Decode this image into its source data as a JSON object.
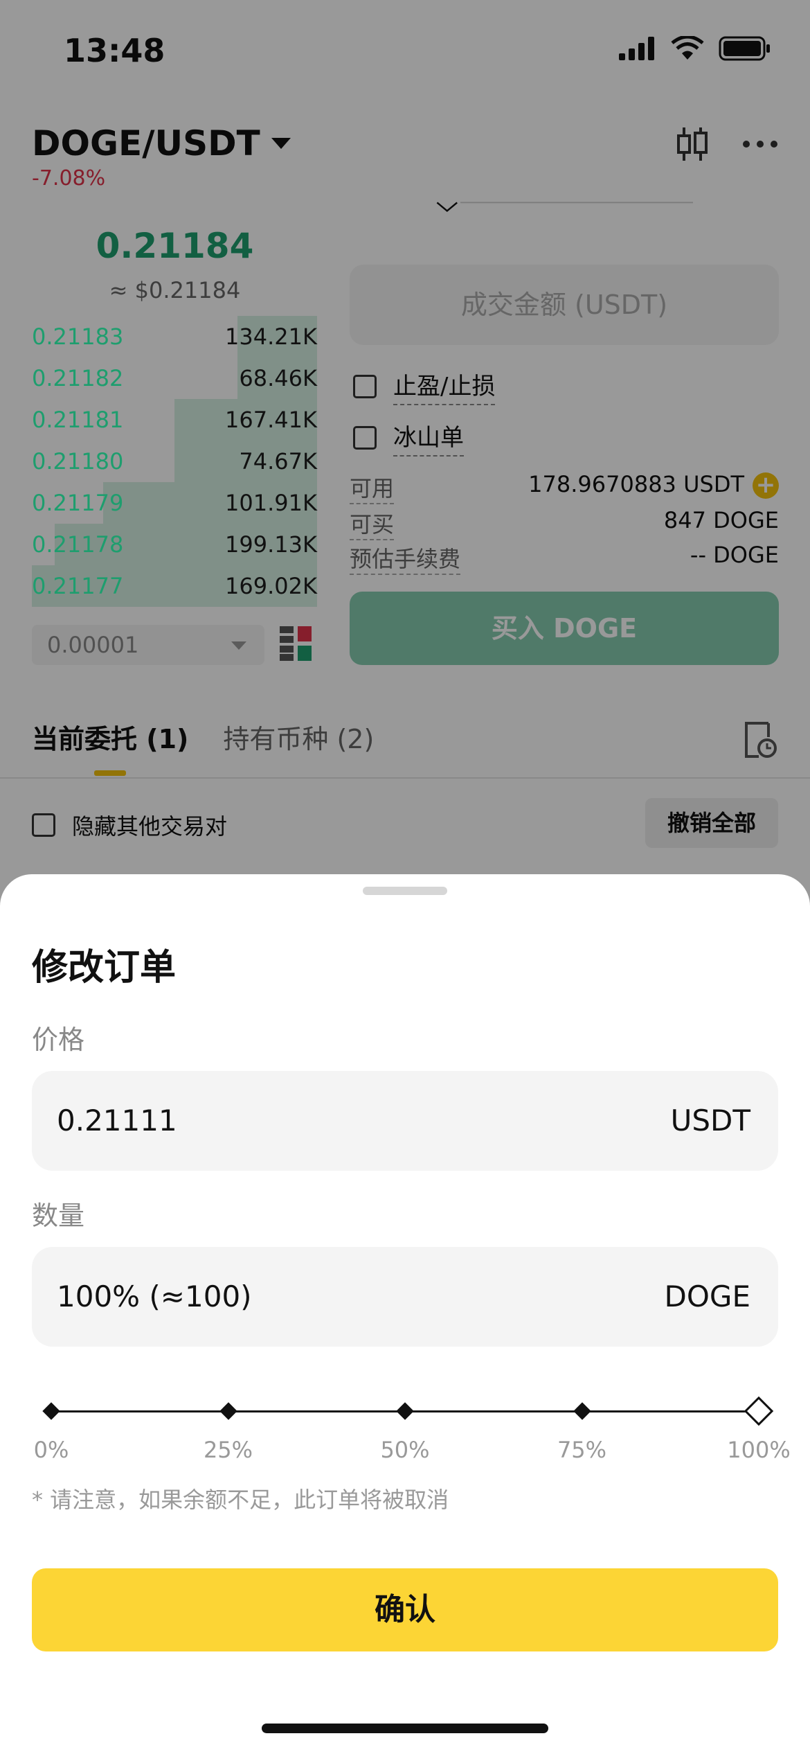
{
  "status_bar": {
    "time": "13:48"
  },
  "header": {
    "pair": "DOGE/USDT",
    "change": "-7.08%"
  },
  "ticker": {
    "last_price": "0.21184",
    "last_price_usd": "≈ $0.21184"
  },
  "order_book": {
    "rows": [
      {
        "price": "0.21183",
        "qty": "134.21K",
        "depth": 0.28
      },
      {
        "price": "0.21182",
        "qty": "68.46K",
        "depth": 0.28
      },
      {
        "price": "0.21181",
        "qty": "167.41K",
        "depth": 0.5
      },
      {
        "price": "0.21180",
        "qty": "74.67K",
        "depth": 0.5
      },
      {
        "price": "0.21179",
        "qty": "101.91K",
        "depth": 0.75
      },
      {
        "price": "0.21178",
        "qty": "199.13K",
        "depth": 0.92
      },
      {
        "price": "0.21177",
        "qty": "169.02K",
        "depth": 1.0
      }
    ],
    "precision": "0.00001"
  },
  "order_form": {
    "amount_placeholder": "成交金额 (USDT)",
    "tp_sl_label": "止盈/止损",
    "iceberg_label": "冰山单",
    "available_label": "可用",
    "available_value": "178.9670883 USDT",
    "can_buy_label": "可买",
    "can_buy_value": "847 DOGE",
    "fee_label": "预估手续费",
    "fee_value": "-- DOGE",
    "buy_button": "买入 DOGE"
  },
  "orders_tabs": {
    "current": "当前委托 (1)",
    "holdings": "持有币种 (2)",
    "hide_others_label": "隐藏其他交易对",
    "cancel_all": "撤销全部"
  },
  "modify_sheet": {
    "title": "修改订单",
    "price_label": "价格",
    "price_value": "0.21111",
    "price_unit": "USDT",
    "qty_label": "数量",
    "qty_value": "100% (≈100)",
    "qty_unit": "DOGE",
    "slider": {
      "value_percent": 100,
      "ticks": [
        "0%",
        "25%",
        "50%",
        "75%",
        "100%"
      ]
    },
    "note": "* 请注意，如果余额不足，此订单将被取消",
    "confirm": "确认"
  },
  "colors": {
    "accent": "#fcd535",
    "up": "#1e9e6e",
    "down": "#e0334a"
  }
}
